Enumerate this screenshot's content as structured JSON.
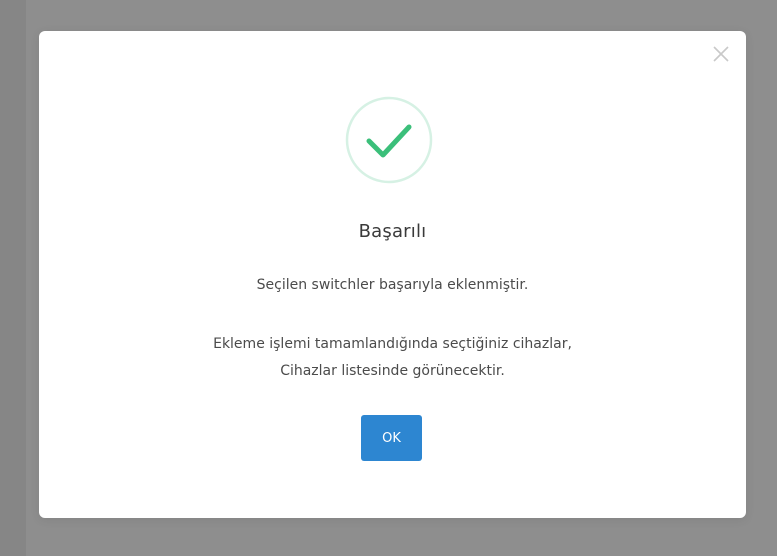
{
  "modal": {
    "title": "Başarılı",
    "messages": [
      "Seçilen switchler başarıyla eklenmiştir.",
      "Ekleme işlemi tamamlandığında seçtiğiniz cihazlar,",
      "Cihazlar listesinde görünecektir."
    ],
    "ok_label": "OK"
  },
  "icons": {
    "success": "check-circle-icon",
    "close": "close-icon"
  },
  "colors": {
    "success_green": "#3bbf7a",
    "success_ring": "#d6f1e4",
    "primary_button": "#2d86d1",
    "backdrop": "#8e8e8e"
  }
}
